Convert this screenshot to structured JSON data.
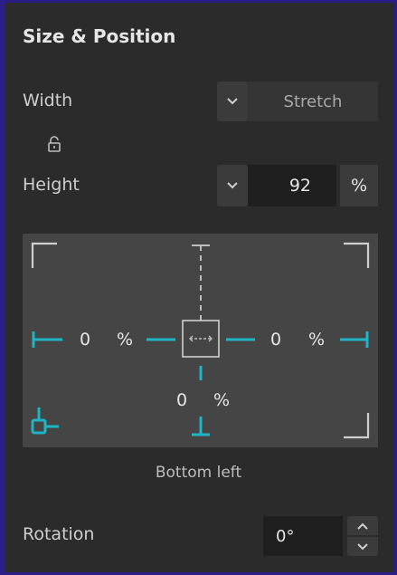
{
  "panel": {
    "title": "Size & Position"
  },
  "width": {
    "label": "Width",
    "value": "Stretch"
  },
  "height": {
    "label": "Height",
    "value": "92",
    "unit": "%"
  },
  "anchor": {
    "left": {
      "value": "0",
      "unit": "%"
    },
    "right": {
      "value": "0",
      "unit": "%"
    },
    "bottom": {
      "value": "0",
      "unit": "%"
    },
    "label": "Bottom left"
  },
  "rotation": {
    "label": "Rotation",
    "value": "0°"
  },
  "colors": {
    "accent": "#1fb5c4",
    "panel": "#2b2b2b",
    "field": "#1f1f1f",
    "frame": "#2a1d86"
  },
  "icons": [
    "lock-icon",
    "chevron-down-icon",
    "chevron-up-icon",
    "move-arrows-icon"
  ]
}
